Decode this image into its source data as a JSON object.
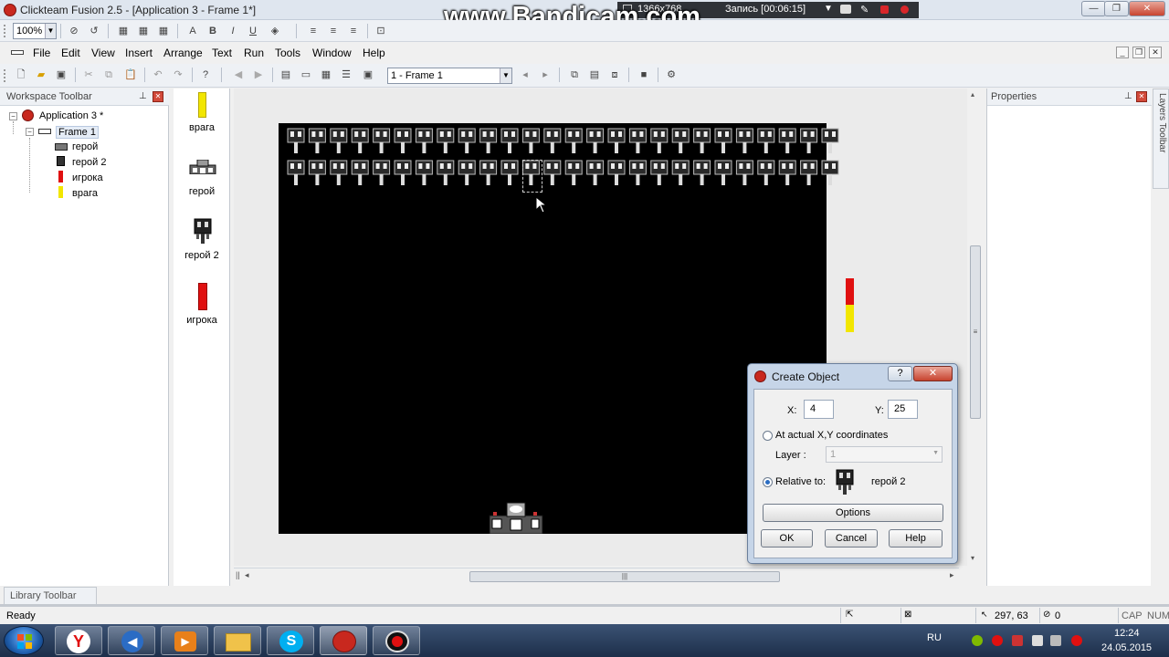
{
  "window": {
    "title": "Clickteam Fusion 2.5 - [Application 3 - Frame 1*]",
    "minimize": "—",
    "maximize": "❐",
    "close": "✕"
  },
  "bandicam": {
    "watermark": "www.Bandicam.com",
    "resolution": "1366x768",
    "recording": "Запись [00:06:15]"
  },
  "toolbar": {
    "zoom": "100%"
  },
  "menu": {
    "items": [
      "File",
      "Edit",
      "View",
      "Insert",
      "Arrange",
      "Text",
      "Run",
      "Tools",
      "Window",
      "Help"
    ]
  },
  "frame_nav": {
    "current": "1 - Frame 1"
  },
  "workspace": {
    "title": "Workspace Toolbar",
    "application": "Application 3 *",
    "frame": "Frame 1",
    "objects": [
      "герой",
      "герой 2",
      "игрока",
      "врага"
    ]
  },
  "shelf": {
    "labels": [
      "врага",
      "герой",
      "герой 2",
      "игрока"
    ]
  },
  "properties": {
    "title": "Properties",
    "layers_tab": "Layers Toolbar"
  },
  "library": {
    "tab": "Library Toolbar"
  },
  "status": {
    "text": "Ready",
    "coords": "297, 63",
    "count": "0",
    "cap": "CAP",
    "num": "NUM"
  },
  "dialog": {
    "title": "Create Object",
    "help_button": "?",
    "close_button": "✕",
    "x_label": "X:",
    "x_value": "4",
    "y_label": "Y:",
    "y_value": "25",
    "radio_actual": "At actual X,Y coordinates",
    "layer_label": "Layer :",
    "layer_value": "1",
    "radio_relative": "Relative to:",
    "relative_object": "герой 2",
    "options": "Options",
    "ok": "OK",
    "cancel": "Cancel",
    "help": "Help"
  },
  "tray": {
    "lang": "RU",
    "time": "12:24",
    "date": "24.05.2015"
  },
  "colors": {
    "enemy_yellow": "#f2e600",
    "player_red": "#e01010"
  }
}
